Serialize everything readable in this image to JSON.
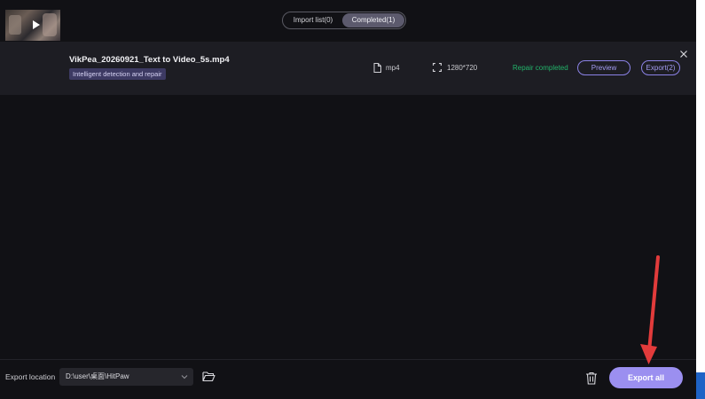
{
  "header": {
    "home_icon": "home-icon",
    "tabs": [
      {
        "label": "Import list(0)",
        "active": false
      },
      {
        "label": "Completed(1)",
        "active": true
      }
    ]
  },
  "file": {
    "name": "VikPea_20260921_Text to Video_5s.mp4",
    "badge": "Intelligent detection and repair",
    "format": "mp4",
    "resolution": "1280*720",
    "status": "Repair completed",
    "preview_label": "Preview",
    "export_label": "Export(2)"
  },
  "footer": {
    "export_location_label": "Export location",
    "export_path": "D:\\user\\桌面\\HitPaw",
    "export_all_label": "Export all"
  },
  "colors": {
    "accent": "#9b8ff0",
    "status_green": "#22b46a",
    "annotation_arrow": "#e23b3b"
  }
}
